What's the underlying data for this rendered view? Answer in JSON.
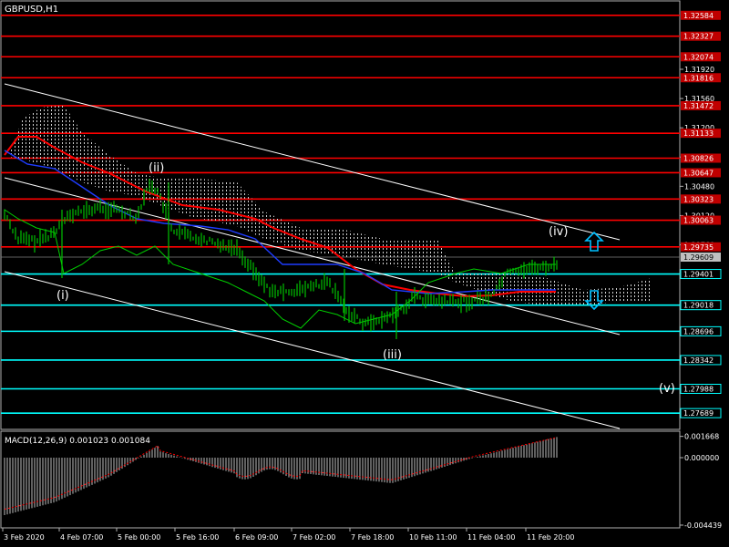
{
  "window": {
    "title": "GBPUSD,H1"
  },
  "main_chart": {
    "price_min": 1.275,
    "price_max": 1.3275,
    "resistance_labels": [
      "1.32584",
      "1.32327",
      "1.32074",
      "1.31816",
      "1.31472",
      "1.31133",
      "1.30826",
      "1.30647",
      "1.30323",
      "1.30063",
      "1.29735"
    ],
    "support_labels": [
      "1.29401",
      "1.29018",
      "1.28696",
      "1.28342",
      "1.27988",
      "1.27689"
    ],
    "current_price": "1.29609",
    "scale_ticks": [
      "1.31920",
      "1.31560",
      "1.31200",
      "1.30840",
      "1.30480",
      "1.30120",
      "1.29760"
    ],
    "wave_labels": [
      "(i)",
      "(ii)",
      "(iii)",
      "(iv)",
      "(v)"
    ],
    "arrows": {
      "up": "up-arrow",
      "down": "down-arrow"
    }
  },
  "time_axis": [
    "3 Feb 2020",
    "4 Feb 07:00",
    "5 Feb 00:00",
    "5 Feb 16:00",
    "6 Feb 09:00",
    "7 Feb 02:00",
    "7 Feb 18:00",
    "10 Feb 11:00",
    "11 Feb 04:00",
    "11 Feb 20:00"
  ],
  "macd": {
    "title": "MACD(12,26,9) 0.001023 0.001084",
    "scale_labels": [
      "0.001668",
      "0.000000",
      "-0.004439"
    ]
  },
  "colors": {
    "background": "#000000",
    "resistance": "#ff0000",
    "support": "#00ffff",
    "price_label_bg": "#c00000",
    "current_bg": "#c0c0c0",
    "wave": "#ffffff",
    "candles": "#00c000",
    "ma_red": "#ff0000",
    "ma_blue": "#1e3cff",
    "arrow": "#00bfff"
  }
}
